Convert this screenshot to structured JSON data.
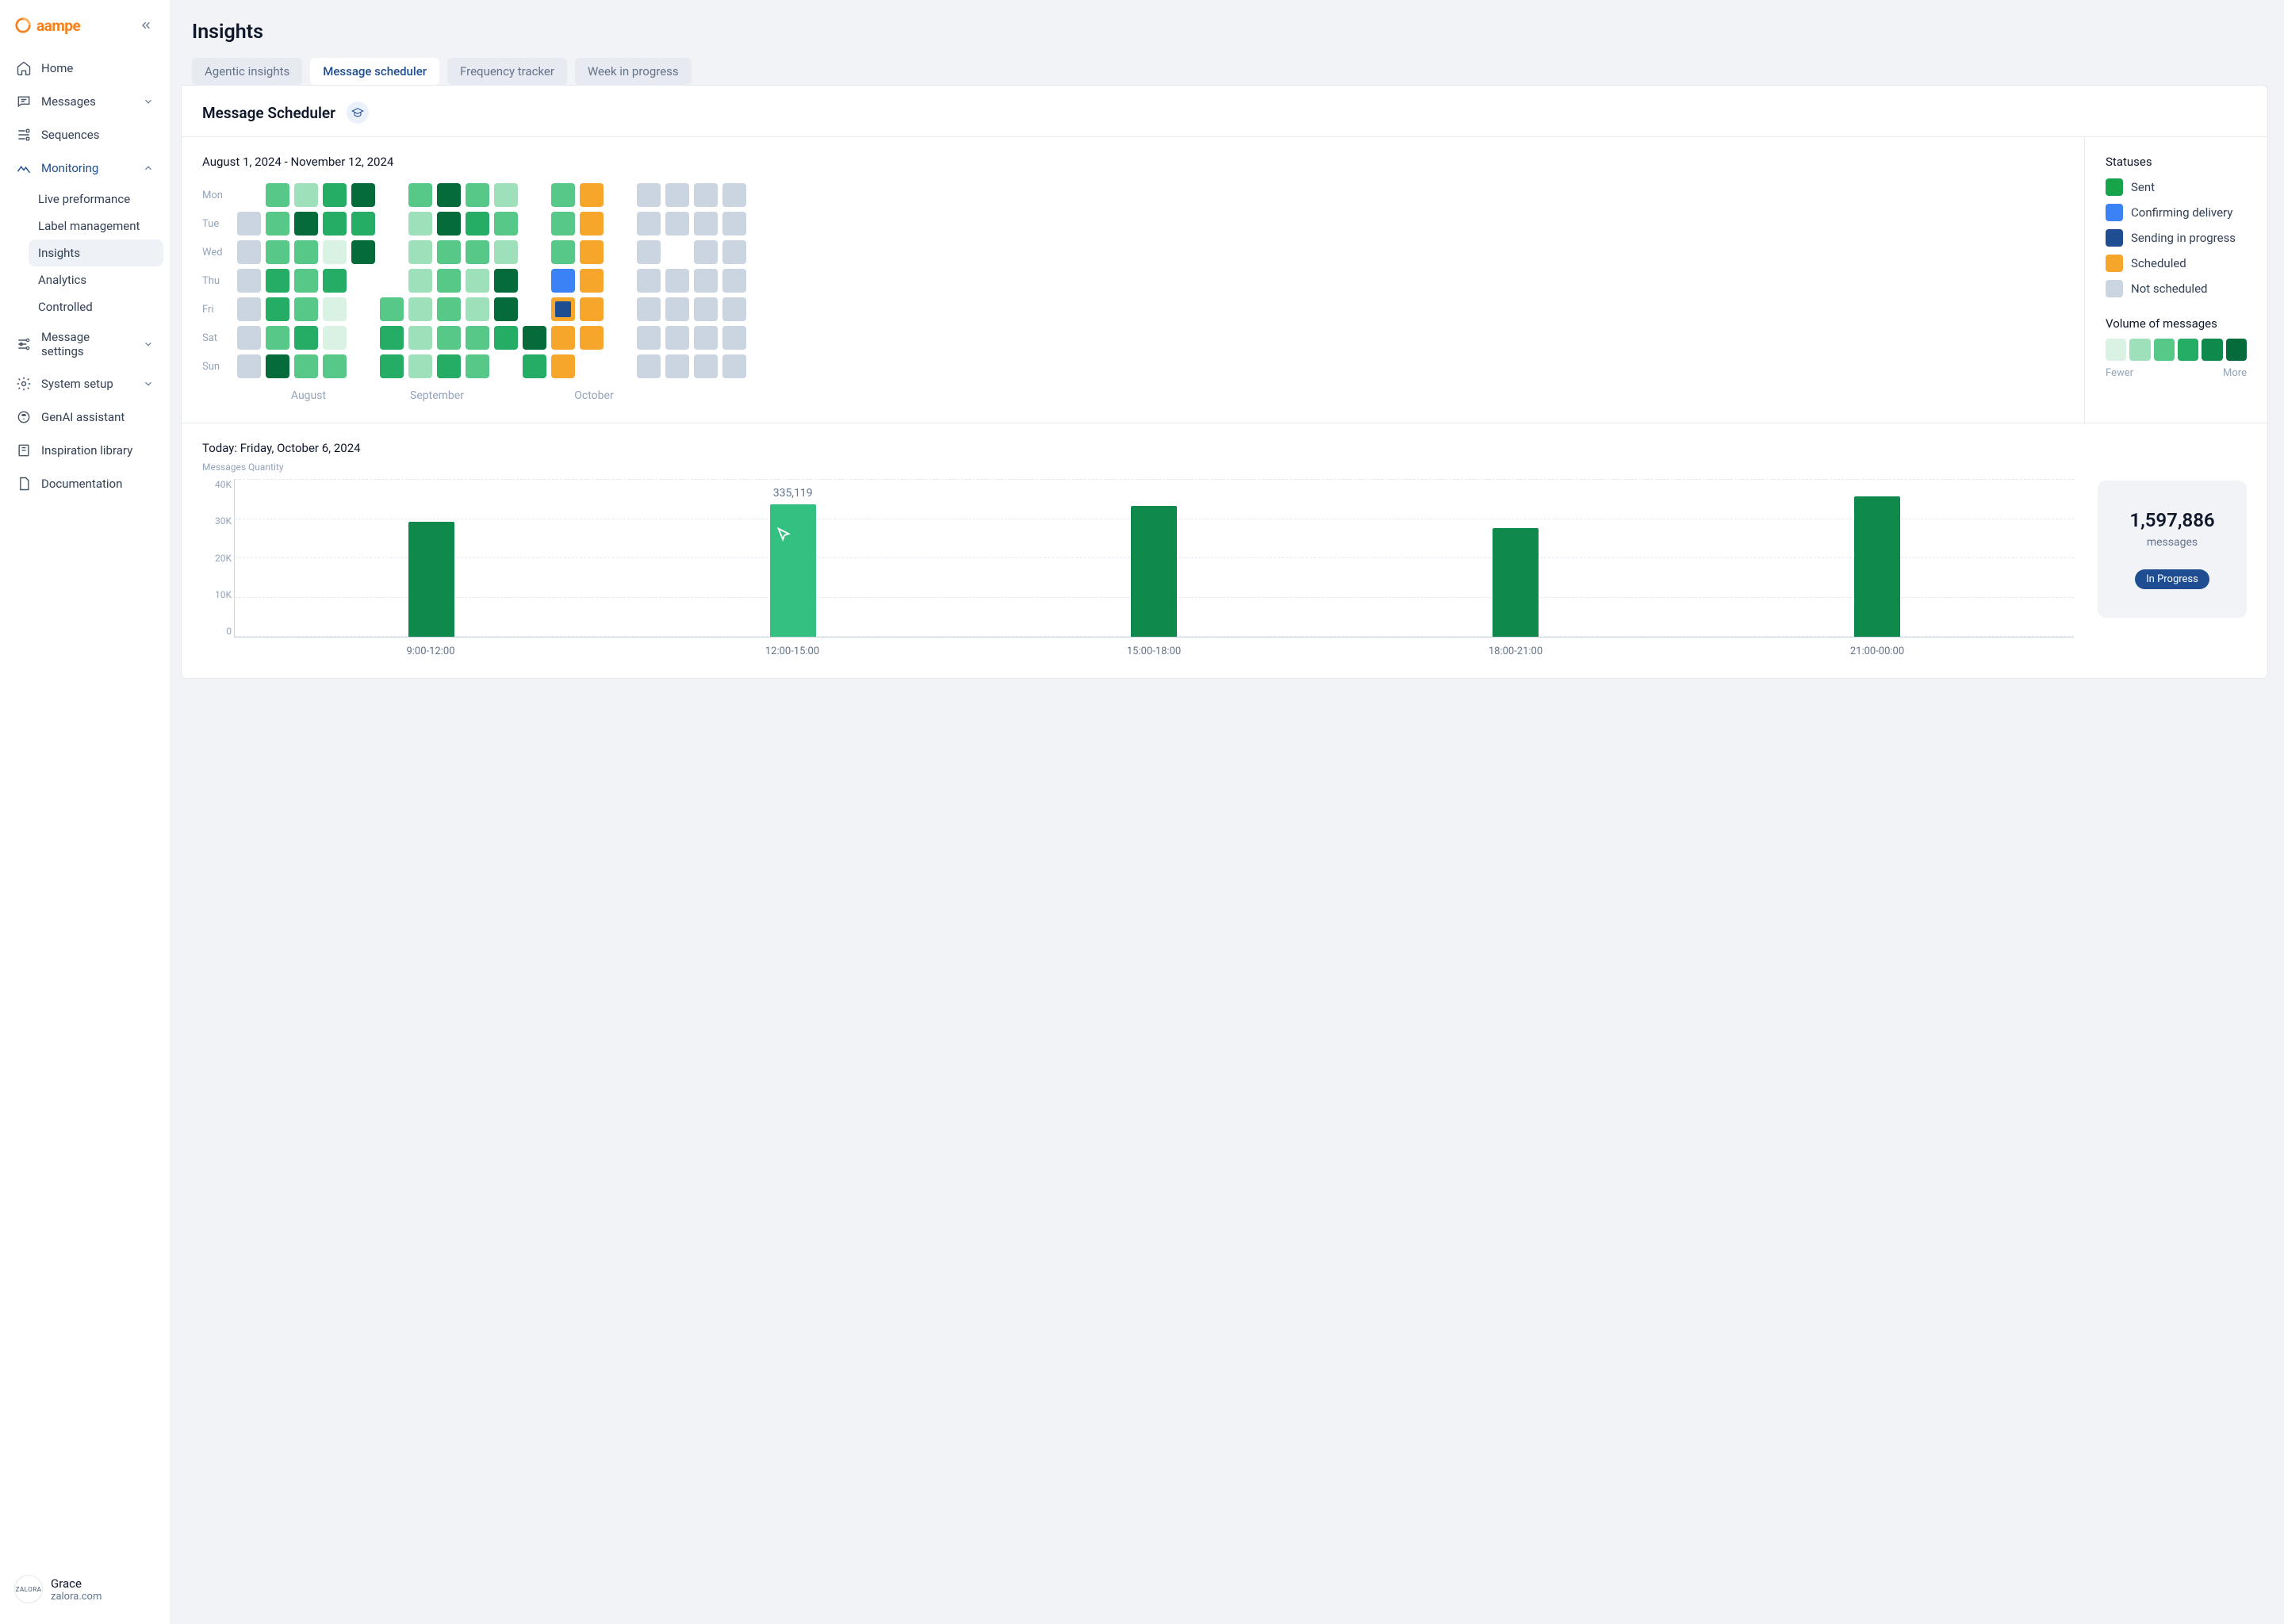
{
  "brand": {
    "name": "aampe"
  },
  "sidebar": {
    "items": [
      {
        "label": "Home"
      },
      {
        "label": "Messages"
      },
      {
        "label": "Sequences"
      },
      {
        "label": "Monitoring"
      },
      {
        "label": "Message settings"
      },
      {
        "label": "System setup"
      },
      {
        "label": "GenAI assistant"
      },
      {
        "label": "Inspiration library"
      },
      {
        "label": "Documentation"
      }
    ],
    "monitoring_children": [
      {
        "label": "Live preformance"
      },
      {
        "label": "Label management"
      },
      {
        "label": "Insights"
      },
      {
        "label": "Analytics"
      },
      {
        "label": "Controlled"
      }
    ]
  },
  "user": {
    "name": "Grace",
    "site": "zalora.com",
    "avatar_text": "ZALORA"
  },
  "page": {
    "title": "Insights"
  },
  "tabs": [
    {
      "label": "Agentic insights"
    },
    {
      "label": "Message scheduler"
    },
    {
      "label": "Frequency tracker"
    },
    {
      "label": "Week in progress"
    }
  ],
  "scheduler": {
    "title": "Message Scheduler",
    "date_range": "August 1, 2024 - November 12, 2024",
    "dow": [
      "Mon",
      "Tue",
      "Wed",
      "Thu",
      "Fri",
      "Sat",
      "Sun"
    ],
    "months": [
      "August",
      "September",
      "October"
    ]
  },
  "legend": {
    "title": "Statuses",
    "items": [
      {
        "label": "Sent",
        "color": "#16a34a"
      },
      {
        "label": "Confirming delivery",
        "color": "#3b82f6"
      },
      {
        "label": "Sending in progress",
        "color": "#1e4d91"
      },
      {
        "label": "Scheduled",
        "color": "#f6a62a"
      },
      {
        "label": "Not scheduled",
        "color": "#cbd5e1"
      }
    ],
    "volume_title": "Volume of messages",
    "volume_colors": [
      "#d9f2e4",
      "#9ee0b9",
      "#57c887",
      "#26ad65",
      "#0f8a4c",
      "#066b3a"
    ],
    "fewer": "Fewer",
    "more": "More"
  },
  "today": {
    "title": "Today: Friday, October 6, 2024",
    "y_label": "Messages Quantity"
  },
  "summary": {
    "number": "1,597,886",
    "label": "messages",
    "badge": "In Progress"
  },
  "chart_data": {
    "heatmap": {
      "type": "heatmap",
      "rows": [
        "Mon",
        "Tue",
        "Wed",
        "Thu",
        "Fri",
        "Sat",
        "Sun"
      ],
      "columns_count": 18,
      "month_spans": [
        5,
        4,
        7
      ],
      "cells": [
        [
          "",
          "s3",
          "s2",
          "s4",
          "s5",
          "",
          "s3",
          "s5",
          "s3",
          "s2",
          "",
          "s3",
          "sch",
          "",
          "ns",
          "ns",
          "ns",
          "ns"
        ],
        [
          "ns",
          "s3",
          "s5",
          "s4",
          "s4",
          "",
          "s2",
          "s5",
          "s4",
          "s3",
          "",
          "s3",
          "sch",
          "",
          "ns",
          "ns",
          "ns",
          "ns"
        ],
        [
          "ns",
          "s3",
          "s3",
          "s1",
          "s5",
          "",
          "s2",
          "s3",
          "s3",
          "s2",
          "",
          "s3",
          "sch",
          "",
          "ns",
          "",
          "ns",
          "ns"
        ],
        [
          "ns",
          "s4",
          "s3",
          "s4",
          "",
          "",
          "s2",
          "s3",
          "s2",
          "s5",
          "",
          "cnf",
          "sch",
          "",
          "ns",
          "ns",
          "ns",
          "ns"
        ],
        [
          "ns",
          "s4",
          "s3",
          "s1",
          "",
          "s3",
          "s2",
          "s3",
          "s2",
          "s5",
          "",
          "sip",
          "sch",
          "",
          "ns",
          "ns",
          "ns",
          "ns"
        ],
        [
          "ns",
          "s3",
          "s4",
          "s1",
          "",
          "s4",
          "s2",
          "s3",
          "s3",
          "s4",
          "s5",
          "sch",
          "sch",
          "",
          "ns",
          "ns",
          "ns",
          "ns"
        ],
        [
          "ns",
          "s5",
          "s3",
          "s3",
          "",
          "s4",
          "s2",
          "s4",
          "s3",
          "",
          "s4",
          "sch",
          "",
          "",
          "ns",
          "ns",
          "ns",
          "ns"
        ]
      ],
      "color_map": {
        "s1": "#d9f2e4",
        "s2": "#9ee0b9",
        "s3": "#57c887",
        "s4": "#26ad65",
        "s5": "#066b3a",
        "cnf": "#3b82f6",
        "sip": "#1e4d91",
        "sch": "#f6a62a",
        "ns": "#cbd5e1",
        "": "transparent"
      }
    },
    "bar": {
      "type": "bar",
      "categories": [
        "9:00-12:00",
        "12:00-15:00",
        "15:00-18:00",
        "18:00-21:00",
        "21:00-00:00"
      ],
      "values": [
        29000,
        33500,
        33000,
        27500,
        35500
      ],
      "highlight_index": 1,
      "highlight_label": "335,119",
      "ylim": [
        0,
        40000
      ],
      "yticks": [
        "40K",
        "30K",
        "20K",
        "10K",
        "0"
      ],
      "colors": {
        "default": "#0f8a4c",
        "highlight": "#34c080"
      }
    }
  }
}
